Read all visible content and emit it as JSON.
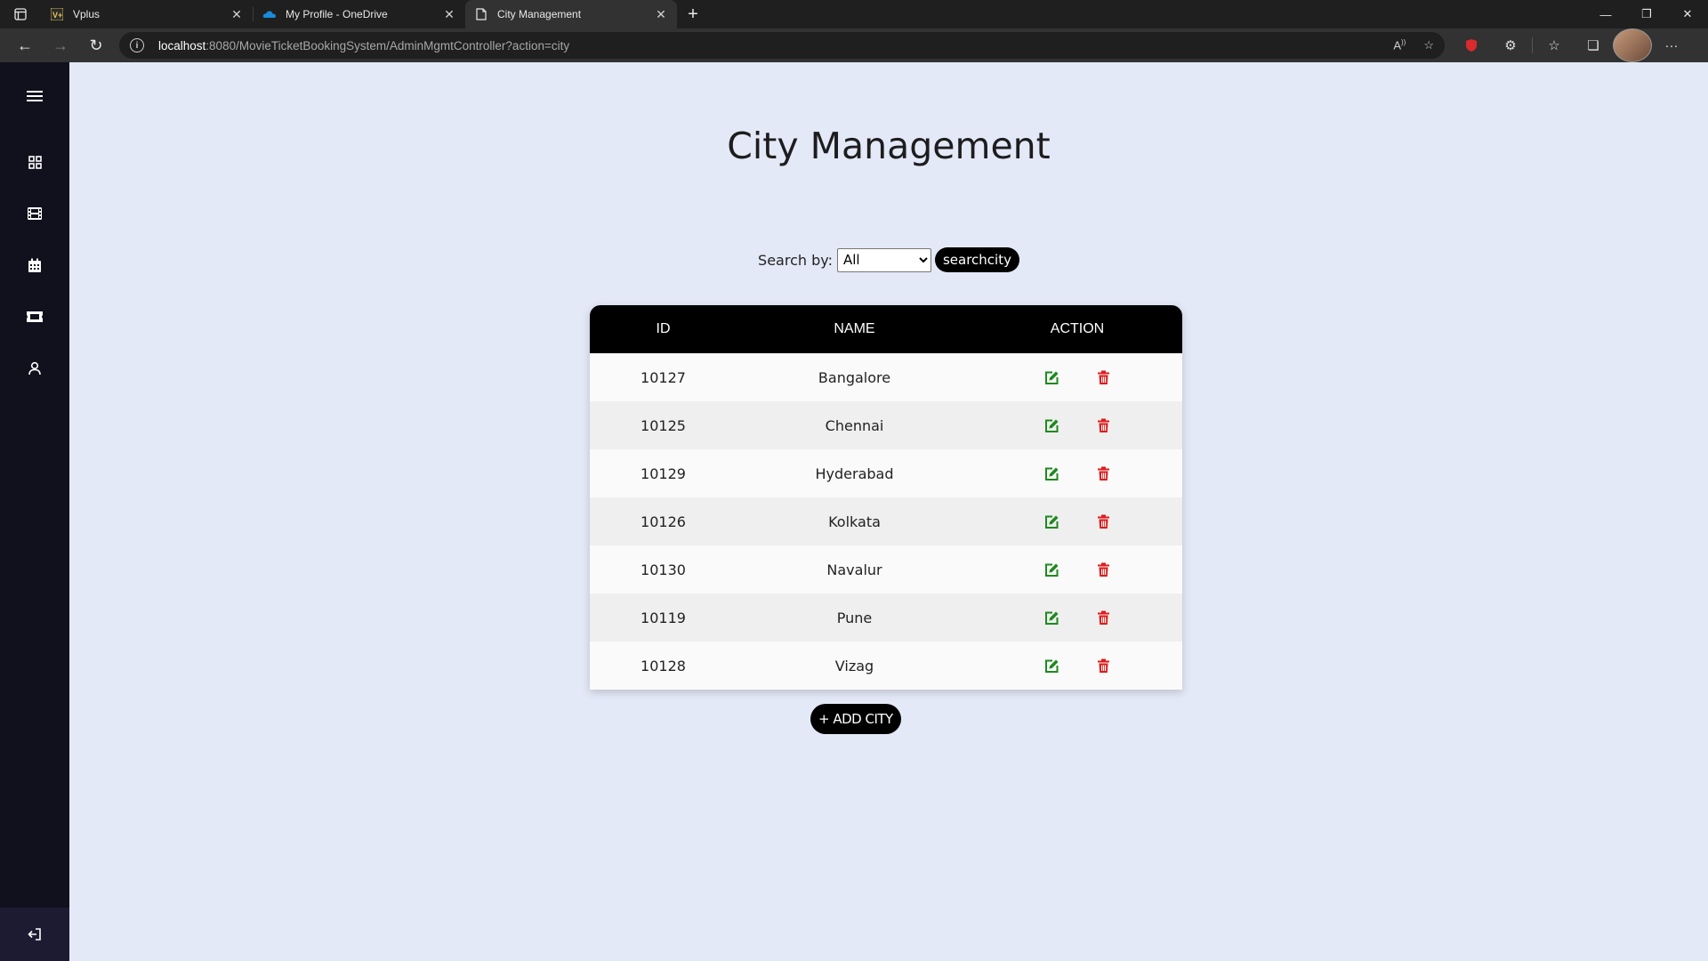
{
  "browser": {
    "tabs": [
      {
        "title": "Vplus",
        "icon": "vplus-favicon"
      },
      {
        "title": "My Profile - OneDrive",
        "icon": "onedrive-favicon"
      },
      {
        "title": "City Management",
        "icon": "page-favicon",
        "active": true
      }
    ],
    "url_host": "localhost",
    "url_rest": ":8080/MovieTicketBookingSystem/AdminMgmtController?action=city"
  },
  "sidebar": {
    "items": [
      {
        "icon": "menu-icon"
      },
      {
        "icon": "dashboard-grid-icon"
      },
      {
        "icon": "film-icon"
      },
      {
        "icon": "calendar-icon"
      },
      {
        "icon": "ticket-icon"
      },
      {
        "icon": "user-icon"
      }
    ],
    "bottom_icon": "logout-icon"
  },
  "main": {
    "title": "City Management",
    "search_label": "Search by:",
    "search_selected": "All",
    "search_button": "searchcity",
    "add_button": "+ ADD CITY"
  },
  "table": {
    "headers": {
      "id": "ID",
      "name": "NAME",
      "action": "ACTION"
    },
    "rows": [
      {
        "id": "10127",
        "name": "Bangalore"
      },
      {
        "id": "10125",
        "name": "Chennai"
      },
      {
        "id": "10129",
        "name": "Hyderabad"
      },
      {
        "id": "10126",
        "name": "Kolkata"
      },
      {
        "id": "10130",
        "name": "Navalur"
      },
      {
        "id": "10119",
        "name": "Pune"
      },
      {
        "id": "10128",
        "name": "Vizag"
      }
    ]
  },
  "colors": {
    "page_bg": "#e4e9f7",
    "sidebar_bg": "#11101d",
    "edit_icon": "#1e8a1e",
    "delete_icon": "#e01b1b",
    "header_bg": "#000000"
  }
}
